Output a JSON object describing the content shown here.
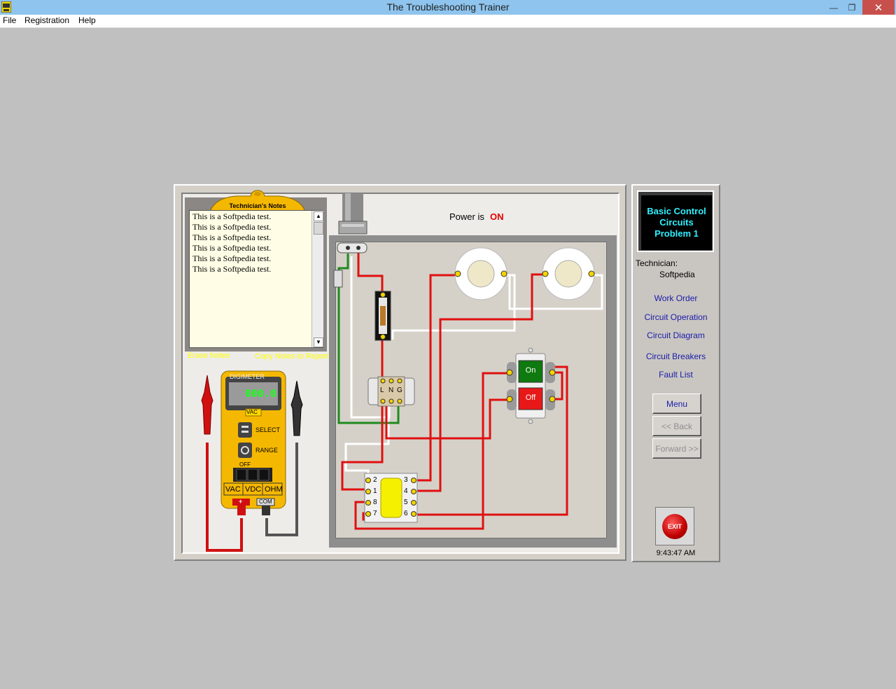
{
  "window": {
    "title": "The Troubleshooting Trainer",
    "minimize_glyph": "—",
    "restore_glyph": "❐",
    "close_glyph": "✕"
  },
  "menu": [
    "File",
    "Registration",
    "Help"
  ],
  "notes": {
    "title": "Technician's Notes",
    "lines": [
      "This is a Softpedia test.",
      "This is a Softpedia test.",
      "This is a Softpedia test.",
      "This is a Softpedia test.",
      "This is a Softpedia test.",
      "This is a Softpedia test."
    ],
    "erase_label": "Erase Notes",
    "copy_label": "Copy Notes to Report"
  },
  "power": {
    "label": "Power is",
    "state": "ON"
  },
  "meter": {
    "brand": "DIGIMETER",
    "display": "000.0",
    "mode_tag": "VAC",
    "select_label": "SELECT",
    "range_label": "RANGE",
    "off_label": "OFF",
    "mode_buttons": [
      "VAC",
      "VDC",
      "OHM"
    ],
    "plus_label": "+",
    "com_label": "COM"
  },
  "circuit": {
    "terminal_block_labels": [
      "L",
      "N",
      "G"
    ],
    "relay_left_pins": [
      "2",
      "1",
      "8",
      "7"
    ],
    "relay_right_pins": [
      "3",
      "4",
      "5",
      "6"
    ],
    "on_label": "On",
    "off_label": "Off"
  },
  "side": {
    "problem": [
      "Basic Control",
      "Circuits",
      "Problem 1"
    ],
    "tech_label": "Technician:",
    "tech_name": "Softpedia",
    "links": [
      "Work Order",
      "Circuit Operation",
      "Circuit Diagram",
      "Circuit Breakers",
      "Fault List"
    ],
    "menu_btn": "Menu",
    "back_btn": "<< Back",
    "forward_btn": "Forward >>",
    "exit_label": "EXIT",
    "clock": "9:43:47 AM"
  },
  "colors": {
    "wire_hot": "#e01010",
    "wire_ground": "#1f8a1f",
    "wire_neutral": "#ffffff",
    "meter_body": "#f5b800",
    "problem_text": "#2ff0ff",
    "link": "#1a1aa8"
  }
}
